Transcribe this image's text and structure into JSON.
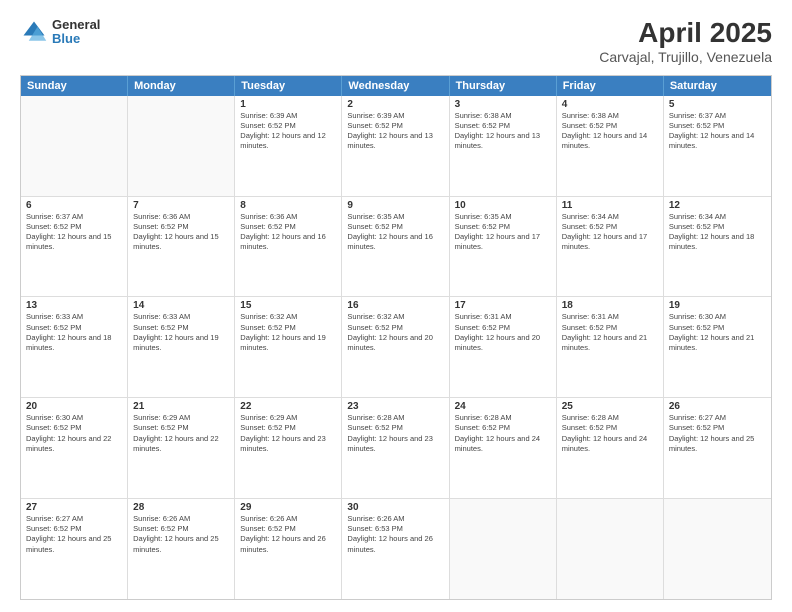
{
  "logo": {
    "line1": "General",
    "line2": "Blue"
  },
  "title": "April 2025",
  "subtitle": "Carvajal, Trujillo, Venezuela",
  "weekdays": [
    "Sunday",
    "Monday",
    "Tuesday",
    "Wednesday",
    "Thursday",
    "Friday",
    "Saturday"
  ],
  "weeks": [
    [
      {
        "day": "",
        "sunrise": "",
        "sunset": "",
        "daylight": ""
      },
      {
        "day": "",
        "sunrise": "",
        "sunset": "",
        "daylight": ""
      },
      {
        "day": "1",
        "sunrise": "Sunrise: 6:39 AM",
        "sunset": "Sunset: 6:52 PM",
        "daylight": "Daylight: 12 hours and 12 minutes."
      },
      {
        "day": "2",
        "sunrise": "Sunrise: 6:39 AM",
        "sunset": "Sunset: 6:52 PM",
        "daylight": "Daylight: 12 hours and 13 minutes."
      },
      {
        "day": "3",
        "sunrise": "Sunrise: 6:38 AM",
        "sunset": "Sunset: 6:52 PM",
        "daylight": "Daylight: 12 hours and 13 minutes."
      },
      {
        "day": "4",
        "sunrise": "Sunrise: 6:38 AM",
        "sunset": "Sunset: 6:52 PM",
        "daylight": "Daylight: 12 hours and 14 minutes."
      },
      {
        "day": "5",
        "sunrise": "Sunrise: 6:37 AM",
        "sunset": "Sunset: 6:52 PM",
        "daylight": "Daylight: 12 hours and 14 minutes."
      }
    ],
    [
      {
        "day": "6",
        "sunrise": "Sunrise: 6:37 AM",
        "sunset": "Sunset: 6:52 PM",
        "daylight": "Daylight: 12 hours and 15 minutes."
      },
      {
        "day": "7",
        "sunrise": "Sunrise: 6:36 AM",
        "sunset": "Sunset: 6:52 PM",
        "daylight": "Daylight: 12 hours and 15 minutes."
      },
      {
        "day": "8",
        "sunrise": "Sunrise: 6:36 AM",
        "sunset": "Sunset: 6:52 PM",
        "daylight": "Daylight: 12 hours and 16 minutes."
      },
      {
        "day": "9",
        "sunrise": "Sunrise: 6:35 AM",
        "sunset": "Sunset: 6:52 PM",
        "daylight": "Daylight: 12 hours and 16 minutes."
      },
      {
        "day": "10",
        "sunrise": "Sunrise: 6:35 AM",
        "sunset": "Sunset: 6:52 PM",
        "daylight": "Daylight: 12 hours and 17 minutes."
      },
      {
        "day": "11",
        "sunrise": "Sunrise: 6:34 AM",
        "sunset": "Sunset: 6:52 PM",
        "daylight": "Daylight: 12 hours and 17 minutes."
      },
      {
        "day": "12",
        "sunrise": "Sunrise: 6:34 AM",
        "sunset": "Sunset: 6:52 PM",
        "daylight": "Daylight: 12 hours and 18 minutes."
      }
    ],
    [
      {
        "day": "13",
        "sunrise": "Sunrise: 6:33 AM",
        "sunset": "Sunset: 6:52 PM",
        "daylight": "Daylight: 12 hours and 18 minutes."
      },
      {
        "day": "14",
        "sunrise": "Sunrise: 6:33 AM",
        "sunset": "Sunset: 6:52 PM",
        "daylight": "Daylight: 12 hours and 19 minutes."
      },
      {
        "day": "15",
        "sunrise": "Sunrise: 6:32 AM",
        "sunset": "Sunset: 6:52 PM",
        "daylight": "Daylight: 12 hours and 19 minutes."
      },
      {
        "day": "16",
        "sunrise": "Sunrise: 6:32 AM",
        "sunset": "Sunset: 6:52 PM",
        "daylight": "Daylight: 12 hours and 20 minutes."
      },
      {
        "day": "17",
        "sunrise": "Sunrise: 6:31 AM",
        "sunset": "Sunset: 6:52 PM",
        "daylight": "Daylight: 12 hours and 20 minutes."
      },
      {
        "day": "18",
        "sunrise": "Sunrise: 6:31 AM",
        "sunset": "Sunset: 6:52 PM",
        "daylight": "Daylight: 12 hours and 21 minutes."
      },
      {
        "day": "19",
        "sunrise": "Sunrise: 6:30 AM",
        "sunset": "Sunset: 6:52 PM",
        "daylight": "Daylight: 12 hours and 21 minutes."
      }
    ],
    [
      {
        "day": "20",
        "sunrise": "Sunrise: 6:30 AM",
        "sunset": "Sunset: 6:52 PM",
        "daylight": "Daylight: 12 hours and 22 minutes."
      },
      {
        "day": "21",
        "sunrise": "Sunrise: 6:29 AM",
        "sunset": "Sunset: 6:52 PM",
        "daylight": "Daylight: 12 hours and 22 minutes."
      },
      {
        "day": "22",
        "sunrise": "Sunrise: 6:29 AM",
        "sunset": "Sunset: 6:52 PM",
        "daylight": "Daylight: 12 hours and 23 minutes."
      },
      {
        "day": "23",
        "sunrise": "Sunrise: 6:28 AM",
        "sunset": "Sunset: 6:52 PM",
        "daylight": "Daylight: 12 hours and 23 minutes."
      },
      {
        "day": "24",
        "sunrise": "Sunrise: 6:28 AM",
        "sunset": "Sunset: 6:52 PM",
        "daylight": "Daylight: 12 hours and 24 minutes."
      },
      {
        "day": "25",
        "sunrise": "Sunrise: 6:28 AM",
        "sunset": "Sunset: 6:52 PM",
        "daylight": "Daylight: 12 hours and 24 minutes."
      },
      {
        "day": "26",
        "sunrise": "Sunrise: 6:27 AM",
        "sunset": "Sunset: 6:52 PM",
        "daylight": "Daylight: 12 hours and 25 minutes."
      }
    ],
    [
      {
        "day": "27",
        "sunrise": "Sunrise: 6:27 AM",
        "sunset": "Sunset: 6:52 PM",
        "daylight": "Daylight: 12 hours and 25 minutes."
      },
      {
        "day": "28",
        "sunrise": "Sunrise: 6:26 AM",
        "sunset": "Sunset: 6:52 PM",
        "daylight": "Daylight: 12 hours and 25 minutes."
      },
      {
        "day": "29",
        "sunrise": "Sunrise: 6:26 AM",
        "sunset": "Sunset: 6:52 PM",
        "daylight": "Daylight: 12 hours and 26 minutes."
      },
      {
        "day": "30",
        "sunrise": "Sunrise: 6:26 AM",
        "sunset": "Sunset: 6:53 PM",
        "daylight": "Daylight: 12 hours and 26 minutes."
      },
      {
        "day": "",
        "sunrise": "",
        "sunset": "",
        "daylight": ""
      },
      {
        "day": "",
        "sunrise": "",
        "sunset": "",
        "daylight": ""
      },
      {
        "day": "",
        "sunrise": "",
        "sunset": "",
        "daylight": ""
      }
    ]
  ]
}
